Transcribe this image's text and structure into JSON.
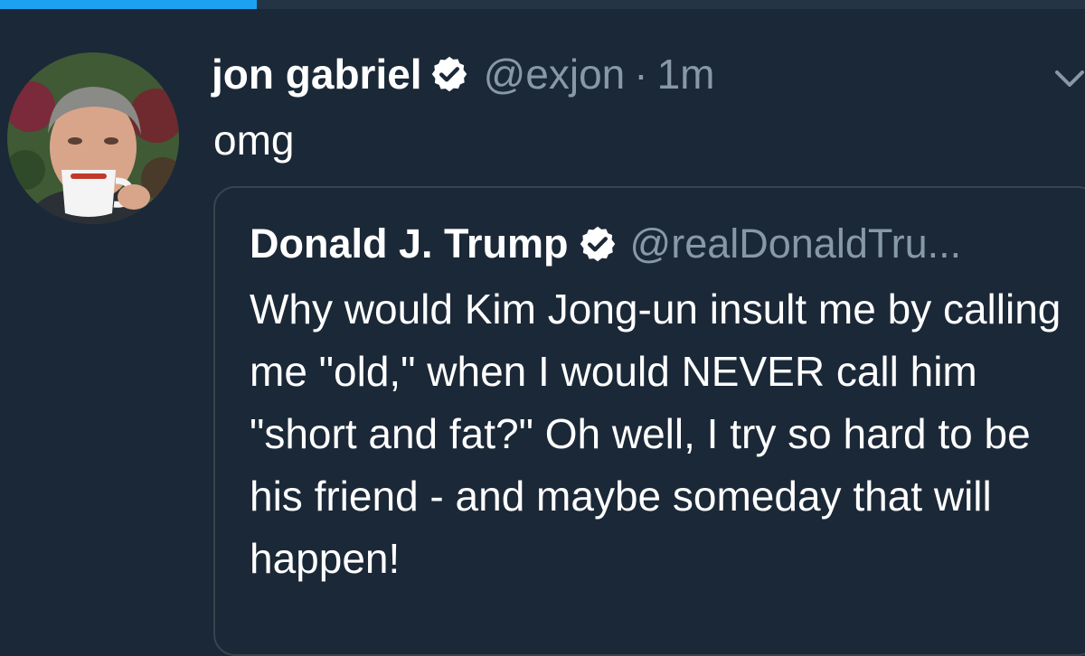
{
  "progress": {
    "fraction": 0.237,
    "color": "#1da1f2"
  },
  "tweet": {
    "author_name": "jon gabriel",
    "handle": "@exjon",
    "separator": "·",
    "time": "1m",
    "text": "omg",
    "avatar_icon": "avatar-photo"
  },
  "quoted": {
    "author_name": "Donald J. Trump",
    "handle": "@realDonaldTru...",
    "text": "Why would Kim Jong-un insult me by calling me \"old,\" when I would NEVER call him \"short and fat?\" Oh well, I try so hard to be his friend - and maybe someday that will happen!"
  },
  "icons": {
    "verified": "verified-badge-icon",
    "menu": "chevron-down-icon"
  },
  "colors": {
    "background": "#1b2837",
    "secondary_text": "#8899a6",
    "border": "#38444d",
    "accent": "#1da1f2"
  }
}
